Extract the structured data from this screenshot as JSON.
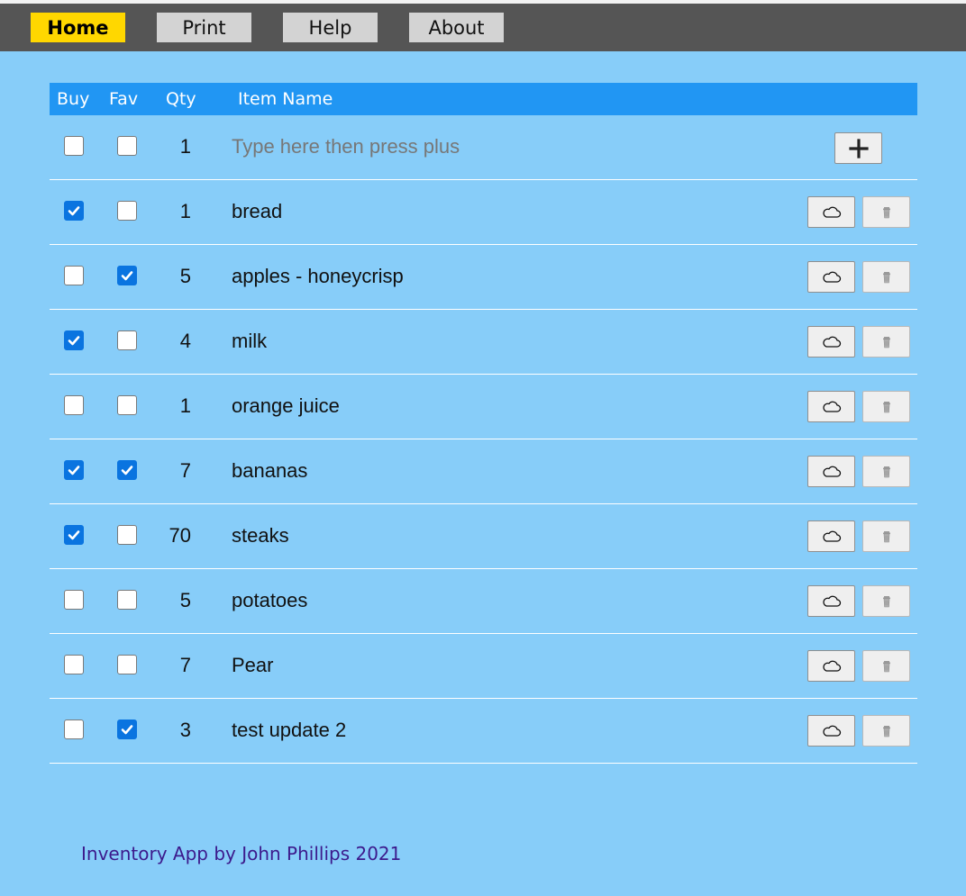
{
  "nav": {
    "items": [
      {
        "label": "Home",
        "active": true
      },
      {
        "label": "Print",
        "active": false
      },
      {
        "label": "Help",
        "active": false
      },
      {
        "label": "About",
        "active": false
      }
    ]
  },
  "table": {
    "headers": {
      "buy": "Buy",
      "fav": "Fav",
      "qty": "Qty",
      "name": "Item Name"
    },
    "new_item": {
      "buy": false,
      "fav": false,
      "qty": "1",
      "placeholder": "Type here then press plus"
    },
    "items": [
      {
        "buy": true,
        "fav": false,
        "qty": "1",
        "name": "bread"
      },
      {
        "buy": false,
        "fav": true,
        "qty": "5",
        "name": "apples - honeycrisp"
      },
      {
        "buy": true,
        "fav": false,
        "qty": "4",
        "name": "milk"
      },
      {
        "buy": false,
        "fav": false,
        "qty": "1",
        "name": "orange juice"
      },
      {
        "buy": true,
        "fav": true,
        "qty": "7",
        "name": "bananas"
      },
      {
        "buy": true,
        "fav": false,
        "qty": "70",
        "name": "steaks"
      },
      {
        "buy": false,
        "fav": false,
        "qty": "5",
        "name": "potatoes"
      },
      {
        "buy": false,
        "fav": false,
        "qty": "7",
        "name": "Pear"
      },
      {
        "buy": false,
        "fav": true,
        "qty": "3",
        "name": "test update 2"
      }
    ]
  },
  "icons": {
    "add": "plus-icon",
    "save": "cloud-icon",
    "delete": "trash-icon"
  },
  "footer": {
    "text": "Inventory App by John Phillips 2021"
  },
  "colors": {
    "background": "#87cdf9",
    "navbar": "#555555",
    "nav_active": "#ffd700",
    "nav_button": "#d3d3d3",
    "header": "#2196f3",
    "checkbox_checked": "#0a74e0",
    "footer_text": "#3c1a8c"
  }
}
